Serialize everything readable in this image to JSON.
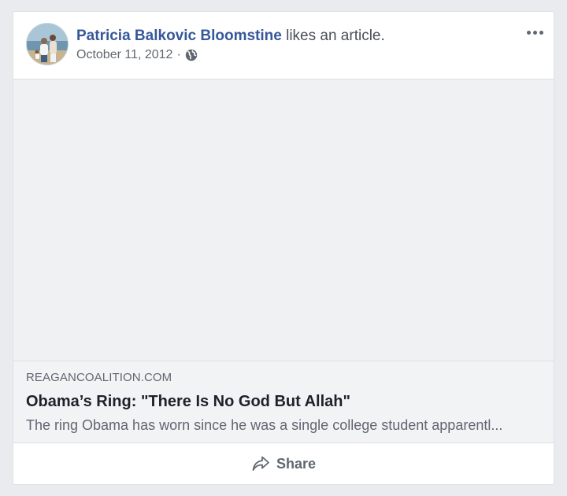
{
  "post": {
    "author": "Patricia Balkovic Bloomstine",
    "action": " likes an article.",
    "date": "October 11, 2012",
    "separator": "·",
    "privacy_icon": "globe-icon",
    "menu_icon": "more-options-icon"
  },
  "link": {
    "domain": "REAGANCOALITION.COM",
    "title": "Obama’s Ring: \"There Is No God But Allah\"",
    "description": "The ring Obama has worn since he was a single college student apparentl..."
  },
  "actions": {
    "share_label": "Share",
    "share_icon": "share-arrow-icon"
  },
  "colors": {
    "author_link": "#365899",
    "page_background": "#e9ebee",
    "card_background": "#ffffff",
    "border": "#dddfe2"
  }
}
